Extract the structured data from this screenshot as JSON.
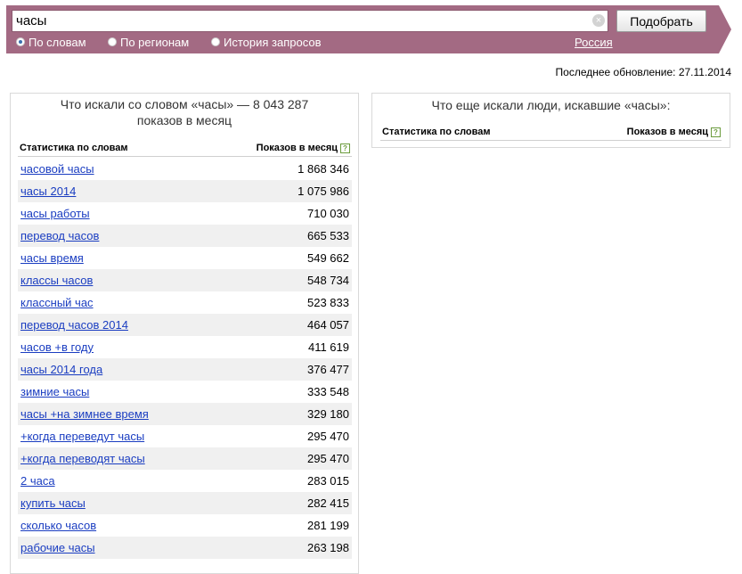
{
  "search": {
    "query": "часы",
    "submit_label": "Подобрать"
  },
  "tabs": [
    {
      "label": "По словам",
      "selected": true
    },
    {
      "label": "По регионам",
      "selected": false
    },
    {
      "label": "История запросов",
      "selected": false
    }
  ],
  "region": "Россия",
  "last_update": "Последнее обновление: 27.11.2014",
  "left_panel": {
    "title_line1": "Что искали со словом «часы» — 8 043 287",
    "title_line2": "показов в месяц",
    "col_keyword": "Статистика по словам",
    "col_count": "Показов в месяц",
    "help": "?",
    "rows": [
      {
        "keyword": "часовой часы",
        "count": "1 868 346"
      },
      {
        "keyword": "часы 2014",
        "count": "1 075 986"
      },
      {
        "keyword": "часы работы",
        "count": "710 030"
      },
      {
        "keyword": "перевод часов",
        "count": "665 533"
      },
      {
        "keyword": "часы время",
        "count": "549 662"
      },
      {
        "keyword": "классы часов",
        "count": "548 734"
      },
      {
        "keyword": "классный час",
        "count": "523 833"
      },
      {
        "keyword": "перевод часов 2014",
        "count": "464 057"
      },
      {
        "keyword": "часов +в году",
        "count": "411 619"
      },
      {
        "keyword": "часы 2014 года",
        "count": "376 477"
      },
      {
        "keyword": "зимние часы",
        "count": "333 548"
      },
      {
        "keyword": "часы +на зимнее время",
        "count": "329 180"
      },
      {
        "keyword": "+когда переведут часы",
        "count": "295 470"
      },
      {
        "keyword": "+когда переводят часы",
        "count": "295 470"
      },
      {
        "keyword": "2 часа",
        "count": "283 015"
      },
      {
        "keyword": "купить часы",
        "count": "282 415"
      },
      {
        "keyword": "сколько часов",
        "count": "281 199"
      },
      {
        "keyword": "рабочие часы",
        "count": "263 198"
      }
    ]
  },
  "right_panel": {
    "title": "Что еще искали люди, искавшие «часы»:",
    "col_keyword": "Статистика по словам",
    "col_count": "Показов в месяц",
    "help": "?"
  },
  "icons": {
    "clear": "clear-icon",
    "help": "help-icon"
  },
  "colors": {
    "header_bg": "#a36a83",
    "link": "#1a3dc1",
    "row_alt": "#f0f0f0"
  }
}
